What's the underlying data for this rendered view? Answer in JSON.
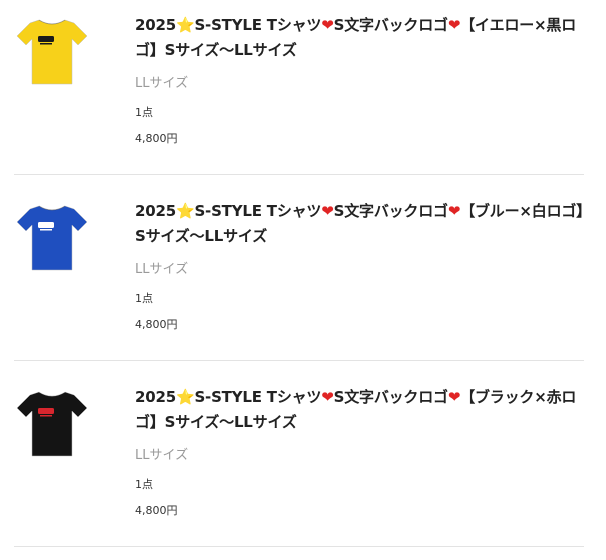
{
  "cart": {
    "items": [
      {
        "title_a": "2025",
        "star": "⭐",
        "title_b": "S-STYLE Tシャツ",
        "heart1": "❤",
        "title_c": "S文字バックロゴ",
        "heart2": "❤",
        "title_d": "【イエロー×黒ロゴ】Sサイズ〜LLサイズ",
        "size": "LLサイズ",
        "quantity": "1点",
        "price": "4,800円",
        "shirt_color": "#f7d11a",
        "logo_color": "#1a1a1a"
      },
      {
        "title_a": "2025",
        "star": "⭐",
        "title_b": "S-STYLE Tシャツ",
        "heart1": "❤",
        "title_c": "S文字バックロゴ",
        "heart2": "❤",
        "title_d": "【ブルー×白ロゴ】Sサイズ〜LLサイズ",
        "size": "LLサイズ",
        "quantity": "1点",
        "price": "4,800円",
        "shirt_color": "#1f4fbf",
        "logo_color": "#ffffff"
      },
      {
        "title_a": "2025",
        "star": "⭐",
        "title_b": "S-STYLE Tシャツ",
        "heart1": "❤",
        "title_c": "S文字バックロゴ",
        "heart2": "❤",
        "title_d": "【ブラック×赤ロゴ】Sサイズ〜LLサイズ",
        "size": "LLサイズ",
        "quantity": "1点",
        "price": "4,800円",
        "shirt_color": "#141414",
        "logo_color": "#d8262e"
      }
    ]
  }
}
